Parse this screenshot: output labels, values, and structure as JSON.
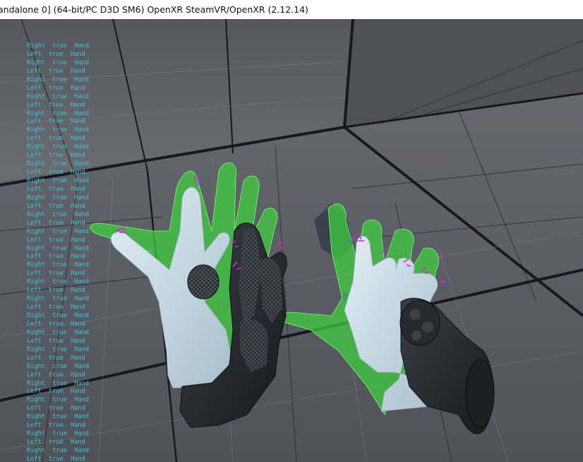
{
  "window": {
    "title": "andalone 0]  (64-bit/PC D3D SM6) OpenXR SteamVR/OpenXR (2.12.14)"
  },
  "debug_log": {
    "lines": [
      "Right  true  Hand",
      "Left  true  Hand",
      "Right  true  Hand",
      "Left  true  Hand",
      "Right  true  Hand",
      "Left  true  Hand",
      "Right  true  Hand",
      "Left  true  Hand",
      "Right  true  Hand",
      "Left  true  Hand",
      "Right  true  Hand",
      "Left  true  Hand",
      "Right  true  Hand",
      "Left  true  Hand",
      "Right  true  Hand",
      "Left  true  Hand",
      "Right  true  Hand",
      "Left  true  Hand",
      "Right  true  Hand",
      "Left  true  Hand",
      "Right  true  Hand",
      "Left  true  Hand",
      "Right  true  Hand",
      "Left  true  Hand",
      "Right  true  Hand",
      "Left  true  Hand",
      "Right  true  Hand",
      "Left  true  Hand",
      "Right  true  Hand",
      "Left  true  Hand",
      "Right  true  Hand",
      "Left  true  Hand",
      "Right  true  Hand",
      "Left  true  Hand",
      "Right  true  Hand",
      "Left  true  Hand",
      "Right  true  Hand",
      "Left  true  Hand",
      "Right  true  Hand",
      "Left  true  Hand",
      "Right  true  Hand",
      "Left  true  Hand",
      "Right  true  Hand",
      "Left  true  Hand",
      "Right  true  Hand",
      "Left  true  Hand",
      "Right  true  Hand",
      "Left  true  Hand",
      "Right  true  Hand",
      "Left  true  Hand"
    ]
  },
  "colors": {
    "title_bg": "#ffffff",
    "log_text": "#39c6dd",
    "floor": "#5e6067",
    "grid_line": "#17181b",
    "ghost_hand": "#3fd13f",
    "tracked_hand": "#c7d9e4",
    "glove": "#2a2d31",
    "joint_marker": "#e01fd6"
  },
  "icons": {
    "left_ghost_hand": "ghost-hand-left-icon",
    "right_ghost_hand": "ghost-hand-right-icon",
    "left_tracked_hand": "tracked-hand-left-icon",
    "right_tracked_hand": "tracked-hand-right-icon",
    "left_glove": "glove-left-icon",
    "right_glove": "glove-right-icon"
  }
}
